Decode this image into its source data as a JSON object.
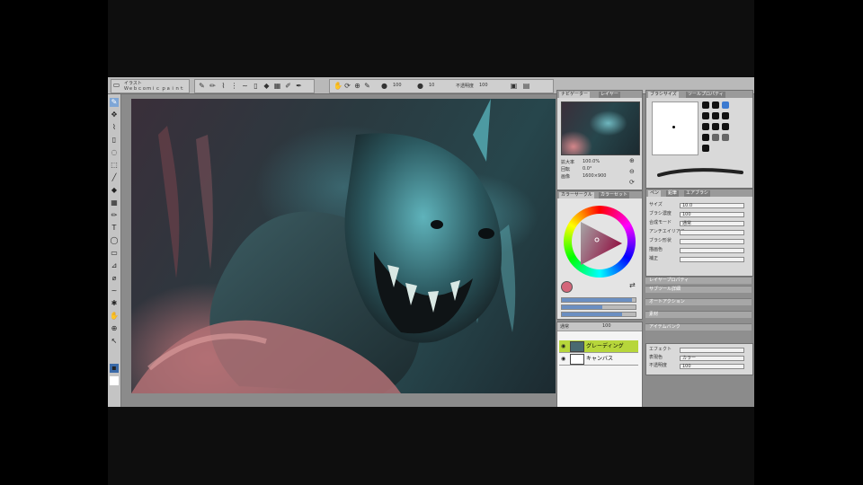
{
  "app": {
    "file_tab_line1": "イラスト",
    "file_tab_line2": "Ｗｅｂｃｏｍｉｃ ｐａｉｎｔ"
  },
  "toolbar": {
    "zoom_value": "100",
    "opacity_label": "不透明度",
    "opacity_value": "100",
    "brush_size_value": "10"
  },
  "navigator": {
    "tabs": [
      "ナビゲーター",
      "レイヤー"
    ],
    "zoom_label": "拡大率",
    "zoom_value": "100.0%",
    "angle_label": "回転",
    "angle_value": "0.0°",
    "size_label": "画像",
    "size_value": "1600×900"
  },
  "brush_panel": {
    "tabs": [
      "ブラシサイズ",
      "ツールプロパティ"
    ]
  },
  "tool_property": {
    "tabs": [
      "ペン",
      "鉛筆",
      "エアブラシ"
    ],
    "rows": [
      {
        "label": "サイズ",
        "value": "10.0"
      },
      {
        "label": "ブラシ濃度",
        "value": "100"
      },
      {
        "label": "合成モード",
        "value": "通常"
      },
      {
        "label": "アンチエイリアス",
        "value": ""
      },
      {
        "label": "ブラシ形状",
        "value": ""
      },
      {
        "label": "描画色",
        "value": ""
      },
      {
        "label": "補正",
        "value": ""
      }
    ]
  },
  "color_panel": {
    "tabs": [
      "カラーサークル",
      "カラーセット"
    ],
    "main_color": "#d4667a",
    "sliders": [
      {
        "label": "H",
        "value": 0.95
      },
      {
        "label": "S",
        "value": 0.55
      },
      {
        "label": "V",
        "value": 0.82
      }
    ]
  },
  "layer_panel": {
    "blend_mode": "通常",
    "opacity": "100",
    "layers": [
      {
        "name": "グレーディング",
        "selected": true,
        "thumb_color": "#4a6a70"
      },
      {
        "name": "キャンバス",
        "selected": false,
        "thumb_color": "#ffffff"
      }
    ]
  },
  "sub_panels": [
    {
      "label": "レイヤープロパティ"
    },
    {
      "label": "サブツール詳細"
    },
    {
      "label": "オートアクション"
    },
    {
      "label": "素材"
    },
    {
      "label": "アイテムバンク"
    }
  ],
  "layer_property": {
    "rows": [
      {
        "label": "エフェクト",
        "value": ""
      },
      {
        "label": "表現色",
        "value": "カラー"
      },
      {
        "label": "不透明度",
        "value": "100"
      }
    ]
  },
  "colors": {
    "selected_layer": "#b7d63b",
    "accent_blue": "#6b8fc2"
  }
}
